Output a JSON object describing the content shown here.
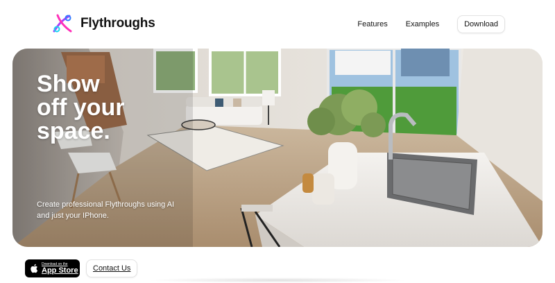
{
  "header": {
    "brand_name": "Flythroughs",
    "logo_icon": "flythroughs-logo-icon",
    "nav": {
      "features": "Features",
      "examples": "Examples",
      "download": "Download"
    }
  },
  "hero": {
    "title_lines": [
      "Show",
      "off your",
      "space."
    ],
    "subtitle": "Create professional Flythroughs using AI and just your IPhone.",
    "image": "living-room-kitchen-photo"
  },
  "actions": {
    "appstore_small": "Download on the",
    "appstore_big": "App Store",
    "contact": "Contact Us"
  },
  "colors": {
    "logo_pink": "#ff2fb8",
    "logo_blue": "#2f7bff",
    "logo_cyan": "#17d6f0",
    "text_dark": "#111111"
  }
}
